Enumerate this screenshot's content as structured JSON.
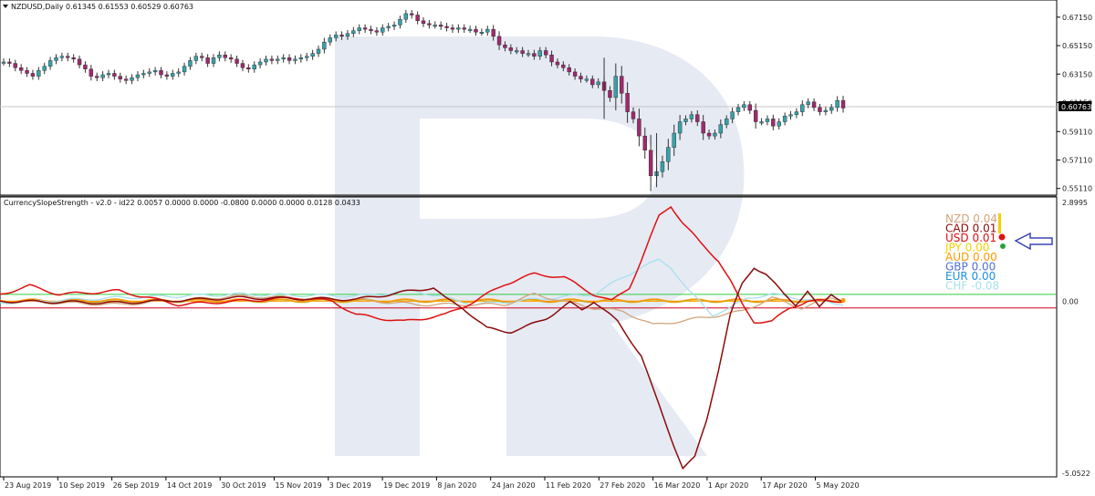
{
  "symbol_header": "NZDUSD,Daily  0.61345 0.61553 0.60529 0.60763",
  "indicator_header": "CurrencySlopeStrength - v2.0 - id22 0.0057 0.0000 0.0000 -0.0800 0.0000 0.0000 0.0128 0.0433",
  "current_price": "0.60763",
  "colors": {
    "bull": "#3aa0a8",
    "bear": "#9e2a6e",
    "frame": "#000000",
    "arrow": "#3a44b8",
    "watermark": "#e6eaf3",
    "level_high": "#2ecc40",
    "level_low": "#d0021b",
    "zero": "#ff9900"
  },
  "chart_data": [
    {
      "type": "candlestick",
      "title": "NZDUSD,Daily",
      "ohlc_last": {
        "open": 0.61345,
        "high": 0.61553,
        "low": 0.60529,
        "close": 0.60763
      },
      "ylim": [
        0.549,
        0.681
      ],
      "y_ticks": [
        "0.67150",
        "0.65150",
        "0.63150",
        "0.61150",
        "0.59110",
        "0.57110",
        "0.55110"
      ],
      "x_ticks": [
        "23 Aug 2019",
        "10 Sep 2019",
        "26 Sep 2019",
        "14 Oct 2019",
        "30 Oct 2019",
        "15 Nov 2019",
        "3 Dec 2019",
        "19 Dec 2019",
        "8 Jan 2020",
        "24 Jan 2020",
        "11 Feb 2020",
        "27 Feb 2020",
        "16 Mar 2020",
        "1 Apr 2020",
        "17 Apr 2020",
        "5 May 2020"
      ],
      "close_path": [
        0.64,
        0.639,
        0.636,
        0.634,
        0.632,
        0.63,
        0.634,
        0.637,
        0.641,
        0.643,
        0.644,
        0.643,
        0.642,
        0.638,
        0.635,
        0.63,
        0.629,
        0.631,
        0.632,
        0.63,
        0.628,
        0.627,
        0.629,
        0.631,
        0.632,
        0.633,
        0.634,
        0.631,
        0.63,
        0.632,
        0.633,
        0.637,
        0.641,
        0.644,
        0.643,
        0.639,
        0.643,
        0.645,
        0.643,
        0.642,
        0.639,
        0.636,
        0.635,
        0.638,
        0.64,
        0.642,
        0.641,
        0.642,
        0.643,
        0.641,
        0.642,
        0.643,
        0.644,
        0.646,
        0.649,
        0.654,
        0.657,
        0.659,
        0.658,
        0.66,
        0.662,
        0.664,
        0.663,
        0.662,
        0.661,
        0.664,
        0.665,
        0.666,
        0.67,
        0.674,
        0.673,
        0.669,
        0.667,
        0.666,
        0.666,
        0.665,
        0.664,
        0.663,
        0.664,
        0.663,
        0.663,
        0.661,
        0.661,
        0.663,
        0.658,
        0.652,
        0.65,
        0.648,
        0.648,
        0.646,
        0.646,
        0.644,
        0.648,
        0.645,
        0.64,
        0.638,
        0.636,
        0.633,
        0.63,
        0.628,
        0.628,
        0.624,
        0.626,
        0.62,
        0.615,
        0.63,
        0.618,
        0.605,
        0.6,
        0.588,
        0.578,
        0.56,
        0.563,
        0.57,
        0.58,
        0.59,
        0.598,
        0.6,
        0.603,
        0.598,
        0.59,
        0.588,
        0.59,
        0.596,
        0.6,
        0.605,
        0.608,
        0.61,
        0.606,
        0.598,
        0.598,
        0.6,
        0.595,
        0.598,
        0.602,
        0.603,
        0.605,
        0.61,
        0.612,
        0.608,
        0.605,
        0.606,
        0.608,
        0.613,
        0.60763
      ],
      "spikes": [
        {
          "date_index": 103,
          "high": 0.643,
          "low": 0.6
        },
        {
          "date_index": 112,
          "high": 0.59,
          "low": 0.552
        }
      ]
    },
    {
      "type": "line",
      "title": "CurrencySlopeStrength - v2.0",
      "ylim": [
        -5.0522,
        2.8995
      ],
      "y_ticks": [
        "2.8995",
        "0.00",
        "-5.0522"
      ],
      "levels": {
        "upper": 0.2,
        "lower": -0.2,
        "zero": 0
      },
      "series": [
        {
          "name": "NZD",
          "color": "#d2a47e",
          "reading": "0.04",
          "width": 1.3,
          "points": [
            [
              0,
              0
            ],
            [
              20,
              -0.1
            ],
            [
              40,
              0.15
            ],
            [
              60,
              0.05
            ],
            [
              70,
              -0.1
            ],
            [
              85,
              -0.1
            ],
            [
              90,
              0.2
            ],
            [
              100,
              -0.2
            ],
            [
              105,
              -0.3
            ],
            [
              110,
              -0.7
            ],
            [
              118,
              -0.5
            ],
            [
              125,
              -0.3
            ],
            [
              130,
              0.1
            ],
            [
              135,
              -0.2
            ],
            [
              140,
              0.1
            ],
            [
              142,
              0.05
            ]
          ]
        },
        {
          "name": "CAD",
          "color": "#8a0b0b",
          "reading": "0.01",
          "width": 1.5,
          "points": [
            [
              0,
              0
            ],
            [
              20,
              -0.05
            ],
            [
              40,
              0.1
            ],
            [
              60,
              0.05
            ],
            [
              73,
              0.4
            ],
            [
              75,
              0.08
            ],
            [
              78,
              -0.2
            ],
            [
              82,
              -0.8
            ],
            [
              86,
              -0.9
            ],
            [
              88,
              -0.8
            ],
            [
              92,
              -0.5
            ],
            [
              96,
              -0.05
            ],
            [
              98,
              -0.25
            ],
            [
              100,
              0
            ],
            [
              104,
              -0.6
            ],
            [
              108,
              -1.6
            ],
            [
              110,
              -2.6
            ],
            [
              113,
              -4.0
            ],
            [
              115,
              -4.9
            ],
            [
              117,
              -4.6
            ],
            [
              119,
              -3.5
            ],
            [
              121,
              -2.0
            ],
            [
              123,
              -0.4
            ],
            [
              125,
              0.5
            ],
            [
              127,
              1.0
            ],
            [
              129,
              0.8
            ],
            [
              132,
              0.2
            ],
            [
              134,
              -0.1
            ],
            [
              136,
              0.3
            ],
            [
              138,
              -0.2
            ],
            [
              140,
              0.2
            ],
            [
              142,
              0.01
            ]
          ]
        },
        {
          "name": "USD",
          "color": "#e01010",
          "reading": "0.01",
          "width": 1.5,
          "points": [
            [
              0,
              0.2
            ],
            [
              5,
              0.45
            ],
            [
              10,
              0.2
            ],
            [
              20,
              0.3
            ],
            [
              30,
              -0.1
            ],
            [
              40,
              0
            ],
            [
              50,
              0.1
            ],
            [
              56,
              0
            ],
            [
              60,
              -0.4
            ],
            [
              68,
              -0.6
            ],
            [
              75,
              -0.4
            ],
            [
              80,
              0
            ],
            [
              85,
              0.5
            ],
            [
              90,
              0.8
            ],
            [
              95,
              0.7
            ],
            [
              100,
              0.2
            ],
            [
              103,
              0
            ],
            [
              106,
              0.4
            ],
            [
              108,
              1.2
            ],
            [
              111,
              2.5
            ],
            [
              113,
              2.8
            ],
            [
              115,
              2.3
            ],
            [
              118,
              1.7
            ],
            [
              121,
              1.2
            ],
            [
              123,
              0.6
            ],
            [
              125,
              -0.1
            ],
            [
              127,
              -0.6
            ],
            [
              130,
              -0.6
            ],
            [
              133,
              -0.2
            ],
            [
              136,
              0
            ],
            [
              140,
              0
            ],
            [
              142,
              0.01
            ]
          ]
        },
        {
          "name": "JPY",
          "color": "#f5d000",
          "reading": "0.00",
          "width": 1.2,
          "points": [
            [
              0,
              0
            ],
            [
              142,
              0
            ]
          ]
        },
        {
          "name": "AUD",
          "color": "#ff9900",
          "reading": "0.00",
          "width": 1.5,
          "points": [
            [
              0,
              0.02
            ],
            [
              142,
              0.02
            ]
          ]
        },
        {
          "name": "GBP",
          "color": "#5070d0",
          "reading": "0.00",
          "width": 1.0,
          "points": [
            [
              0,
              0.02
            ],
            [
              142,
              0.02
            ]
          ]
        },
        {
          "name": "EUR",
          "color": "#2090e0",
          "reading": "0.00",
          "width": 1.0,
          "points": [
            [
              0,
              0.01
            ],
            [
              142,
              0.01
            ]
          ]
        },
        {
          "name": "CHF",
          "color": "#a8e0ee",
          "reading": "-0.08",
          "width": 1.3,
          "points": [
            [
              0,
              -0.05
            ],
            [
              20,
              0.1
            ],
            [
              40,
              0.2
            ],
            [
              60,
              0.15
            ],
            [
              70,
              0.3
            ],
            [
              80,
              -0.1
            ],
            [
              90,
              0.05
            ],
            [
              100,
              0.2
            ],
            [
              108,
              1.0
            ],
            [
              111,
              1.2
            ],
            [
              113,
              1.0
            ],
            [
              116,
              0.3
            ],
            [
              120,
              -0.4
            ],
            [
              123,
              -0.2
            ],
            [
              126,
              0.1
            ],
            [
              130,
              0.2
            ],
            [
              134,
              0.1
            ],
            [
              138,
              0
            ],
            [
              142,
              -0.08
            ]
          ]
        }
      ]
    }
  ]
}
